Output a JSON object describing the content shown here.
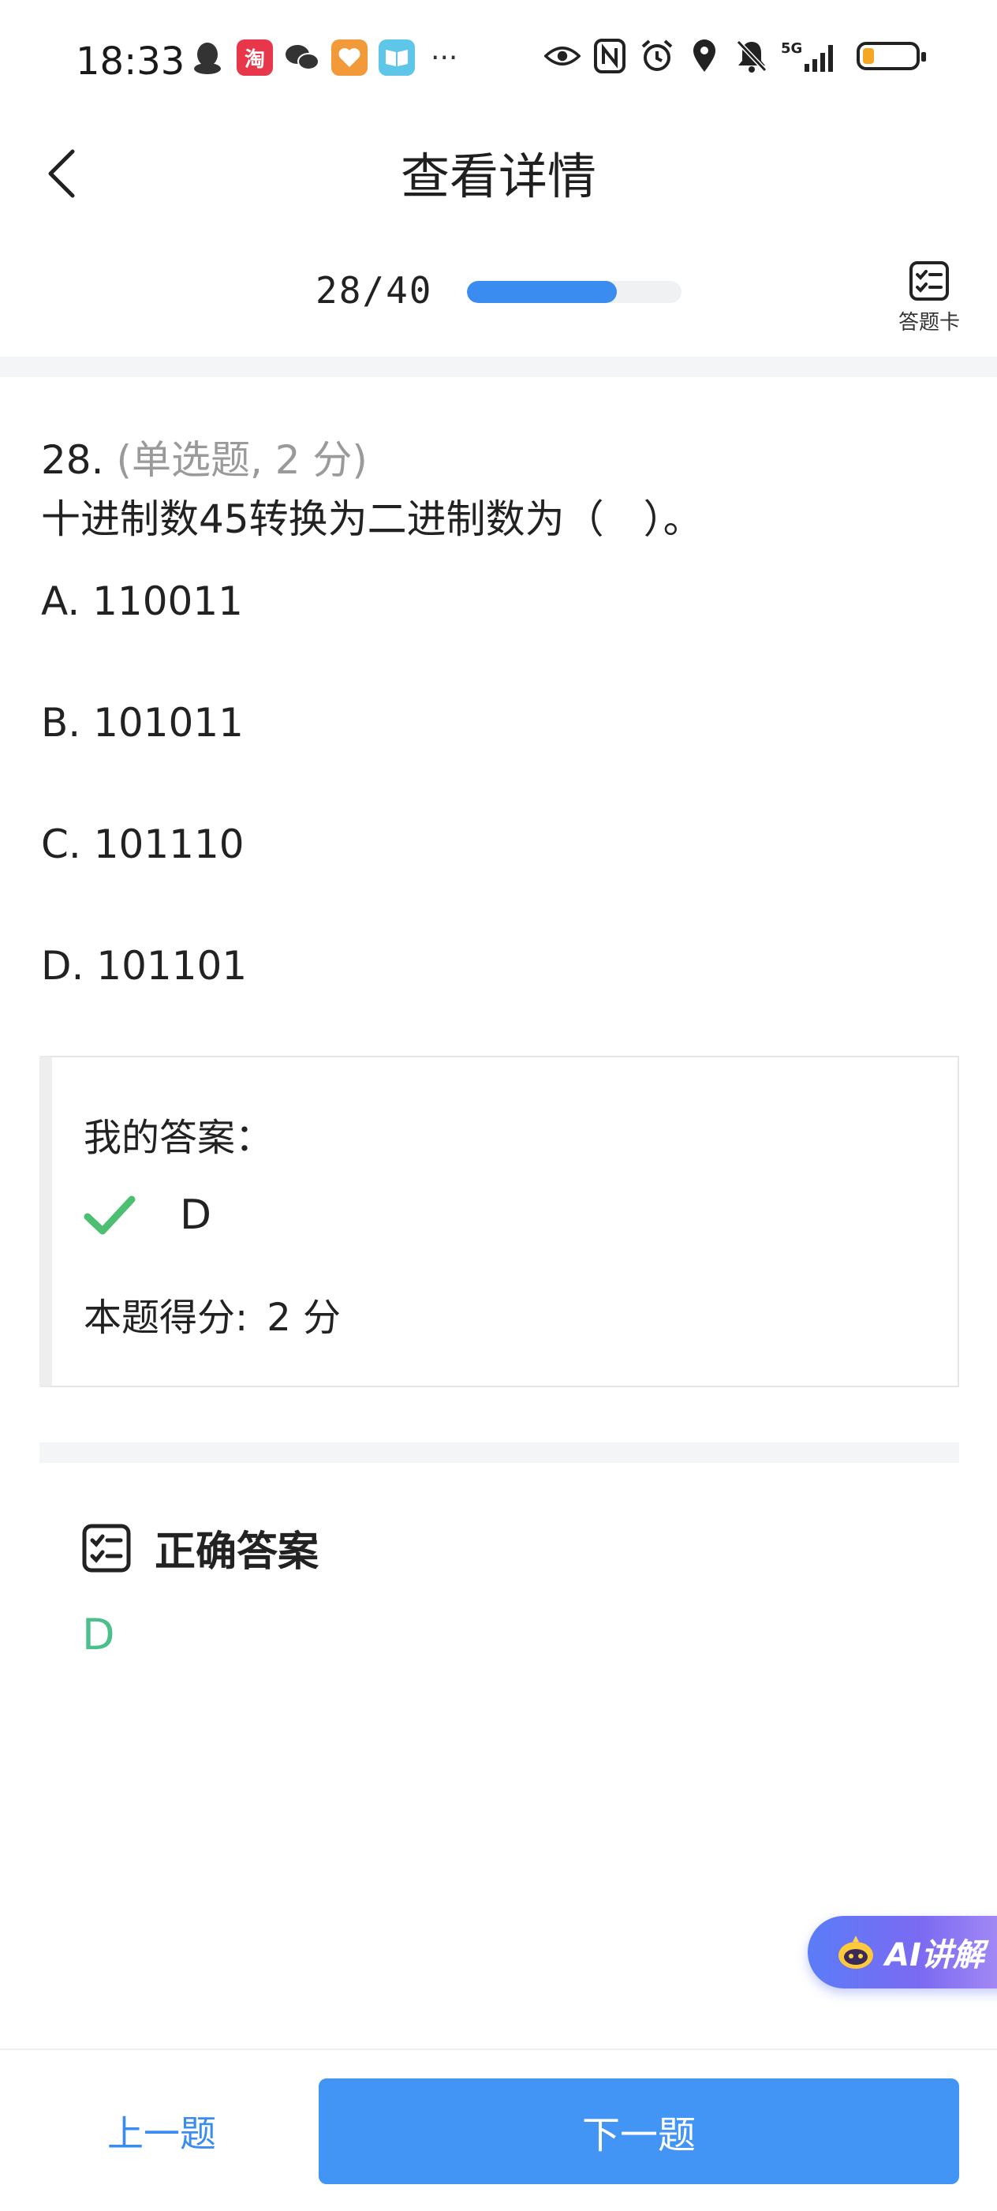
{
  "status_bar": {
    "time": "18:33",
    "network": "5G",
    "left_icons": [
      "qq-icon",
      "taobao-icon",
      "wechat-icon",
      "health-app-icon",
      "reader-app-icon"
    ],
    "right_icons": [
      "eye-icon",
      "nfc-icon",
      "alarm-icon",
      "location-icon",
      "mute-icon",
      "signal-icon",
      "battery-icon"
    ],
    "taobao_label": "淘",
    "more": "···"
  },
  "header": {
    "title": "查看详情"
  },
  "progress": {
    "current": 28,
    "total": 40,
    "label": "28/40",
    "fraction": 0.7,
    "answer_card_label": "答题卡"
  },
  "question": {
    "number": "28.",
    "type": "(单选题, 2 分)",
    "text": "十进制数45转换为二进制数为（　）。",
    "options": [
      {
        "label": "A. 110011"
      },
      {
        "label": "B. 101011"
      },
      {
        "label": "C. 101110"
      },
      {
        "label": "D. 101101"
      }
    ]
  },
  "my_answer": {
    "title": "我的答案：",
    "value": "D",
    "score_label": "本题得分:",
    "score_value": "2 分"
  },
  "correct_answer": {
    "title": "正确答案",
    "value": "D"
  },
  "ai": {
    "label": "AI讲解"
  },
  "footer": {
    "prev_label": "上一题",
    "next_label": "下一题"
  },
  "colors": {
    "accent": "#4294f5",
    "progress_fill": "#3b8cf0",
    "correct_green": "#4cbf8c",
    "check_green": "#4cbf73",
    "battery": "#f5a623"
  }
}
